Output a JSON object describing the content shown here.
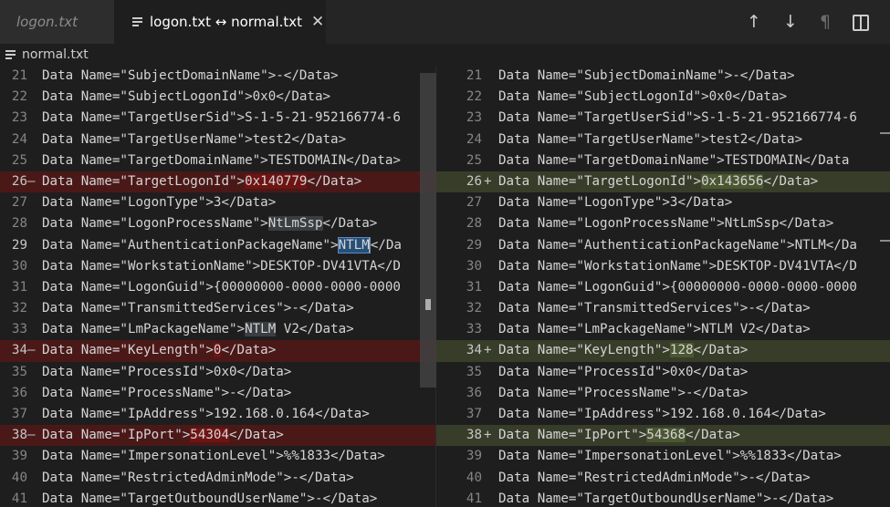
{
  "tabs": [
    {
      "label": "logon.txt",
      "icon": "file-lines-icon"
    },
    {
      "label": "logon.txt ↔ normal.txt",
      "icon": "file-lines-icon",
      "close": "✕"
    }
  ],
  "toolbar": {
    "prev_change": "↑",
    "next_change": "↓",
    "whitespace": "¶",
    "split_editor_icon": "split-editor-icon"
  },
  "breadcrumb": {
    "file": "normal.txt",
    "icon": "file-lines-icon"
  },
  "left_lines": [
    {
      "n": "21",
      "text": "Data Name=\"SubjectDomainName\">-</Data>"
    },
    {
      "n": "22",
      "text": "Data Name=\"SubjectLogonId\">0x0</Data>"
    },
    {
      "n": "23",
      "text": "Data Name=\"TargetUserSid\">S-1-5-21-952166774-6"
    },
    {
      "n": "24",
      "text": "Data Name=\"TargetUserName\">test2</Data>"
    },
    {
      "n": "25",
      "text": "Data Name=\"TargetDomainName\">TESTDOMAIN</Data>"
    },
    {
      "n": "26",
      "mark": "—",
      "pre": "Data Name=\"TargetLogonId\">",
      "chg": "0x140779",
      "post": "</Data>"
    },
    {
      "n": "27",
      "text": "Data Name=\"LogonType\">3</Data>"
    },
    {
      "n": "28",
      "pre": "Data Name=\"LogonProcessName\">",
      "hl": "NtLmSsp",
      "post": "</Data>"
    },
    {
      "n": "29",
      "pre": "Data Name=\"AuthenticationPackageName\">",
      "sel": "NTLM",
      "post": "</Da"
    },
    {
      "n": "30",
      "text": "Data Name=\"WorkstationName\">DESKTOP-DV41VTA</D"
    },
    {
      "n": "31",
      "text": "Data Name=\"LogonGuid\">{00000000-0000-0000-0000"
    },
    {
      "n": "32",
      "text": "Data Name=\"TransmittedServices\">-</Data>"
    },
    {
      "n": "33",
      "pre": "Data Name=\"LmPackageName\">",
      "hl": "NTLM",
      "post": " V2</Data>"
    },
    {
      "n": "34",
      "mark": "—",
      "pre": "Data Name=\"KeyLength\">",
      "chg": "0",
      "post": "</Data>"
    },
    {
      "n": "35",
      "text": "Data Name=\"ProcessId\">0x0</Data>"
    },
    {
      "n": "36",
      "text": "Data Name=\"ProcessName\">-</Data>"
    },
    {
      "n": "37",
      "text": "Data Name=\"IpAddress\">192.168.0.164</Data>"
    },
    {
      "n": "38",
      "mark": "—",
      "pre": "Data Name=\"IpPort\">",
      "chg": "54304",
      "post": "</Data>"
    },
    {
      "n": "39",
      "text": "Data Name=\"ImpersonationLevel\">%%1833</Data>"
    },
    {
      "n": "40",
      "text": "Data Name=\"RestrictedAdminMode\">-</Data>"
    },
    {
      "n": "41",
      "text": "Data Name=\"TargetOutboundUserName\">-</Data>"
    }
  ],
  "right_lines": [
    {
      "n": "21",
      "text": "Data Name=\"SubjectDomainName\">-</Data>"
    },
    {
      "n": "22",
      "text": "Data Name=\"SubjectLogonId\">0x0</Data>"
    },
    {
      "n": "23",
      "text": "Data Name=\"TargetUserSid\">S-1-5-21-952166774-6"
    },
    {
      "n": "24",
      "text": "Data Name=\"TargetUserName\">test2</Data>"
    },
    {
      "n": "25",
      "text": "Data Name=\"TargetDomainName\">TESTDOMAIN</Data"
    },
    {
      "n": "26",
      "mark": "+",
      "pre": "Data Name=\"TargetLogonId\">",
      "chg": "0x143656",
      "post": "</Data>"
    },
    {
      "n": "27",
      "text": "Data Name=\"LogonType\">3</Data>"
    },
    {
      "n": "28",
      "text": "Data Name=\"LogonProcessName\">NtLmSsp</Data>"
    },
    {
      "n": "29",
      "text": "Data Name=\"AuthenticationPackageName\">NTLM</Da"
    },
    {
      "n": "30",
      "text": "Data Name=\"WorkstationName\">DESKTOP-DV41VTA</D"
    },
    {
      "n": "31",
      "text": "Data Name=\"LogonGuid\">{00000000-0000-0000-0000"
    },
    {
      "n": "32",
      "text": "Data Name=\"TransmittedServices\">-</Data>"
    },
    {
      "n": "33",
      "text": "Data Name=\"LmPackageName\">NTLM V2</Data>"
    },
    {
      "n": "34",
      "mark": "+",
      "pre": "Data Name=\"KeyLength\">",
      "chg": "128",
      "post": "</Data>"
    },
    {
      "n": "35",
      "text": "Data Name=\"ProcessId\">0x0</Data>"
    },
    {
      "n": "36",
      "text": "Data Name=\"ProcessName\">-</Data>"
    },
    {
      "n": "37",
      "text": "Data Name=\"IpAddress\">192.168.0.164</Data>"
    },
    {
      "n": "38",
      "mark": "+",
      "pre": "Data Name=\"IpPort\">",
      "chg": "54368",
      "post": "</Data>"
    },
    {
      "n": "39",
      "text": "Data Name=\"ImpersonationLevel\">%%1833</Data>"
    },
    {
      "n": "40",
      "text": "Data Name=\"RestrictedAdminMode\">-</Data>"
    },
    {
      "n": "41",
      "text": "Data Name=\"TargetOutboundUserName\">-</Data>"
    }
  ],
  "colors": {
    "removed_line": "#4b1818",
    "removed_word": "#6f1313",
    "added_line": "#373d29",
    "added_word": "#4b5632",
    "selection": "#264f78"
  }
}
